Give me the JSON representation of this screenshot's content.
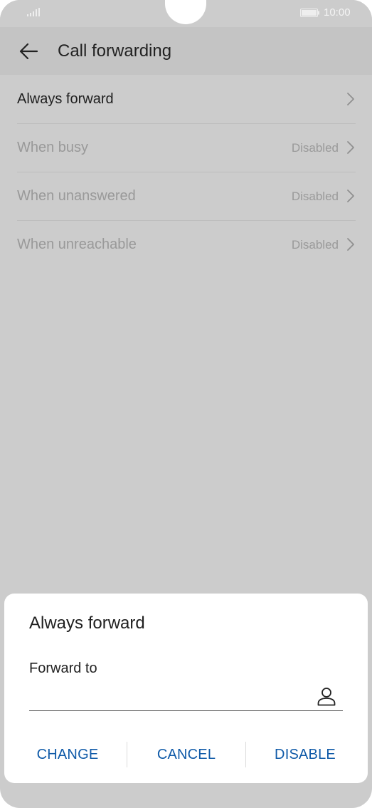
{
  "status_bar": {
    "time": "10:00",
    "signal_icon": "signal-icon",
    "battery_icon": "battery-icon"
  },
  "header": {
    "back_icon": "arrow-left-icon",
    "title": "Call forwarding"
  },
  "settings": {
    "items": [
      {
        "label": "Always forward",
        "value": "",
        "enabled": true
      },
      {
        "label": "When busy",
        "value": "Disabled",
        "enabled": false
      },
      {
        "label": "When unanswered",
        "value": "Disabled",
        "enabled": false
      },
      {
        "label": "When unreachable",
        "value": "Disabled",
        "enabled": false
      }
    ]
  },
  "dialog": {
    "title": "Always forward",
    "field_label": "Forward to",
    "field_value": "",
    "contact_icon": "person-icon",
    "actions": {
      "change": "CHANGE",
      "cancel": "CANCEL",
      "disable": "DISABLE"
    }
  },
  "colors": {
    "scrim": "#cccccc",
    "accent": "#0f5aa8",
    "dialog_bg": "#ffffff"
  }
}
